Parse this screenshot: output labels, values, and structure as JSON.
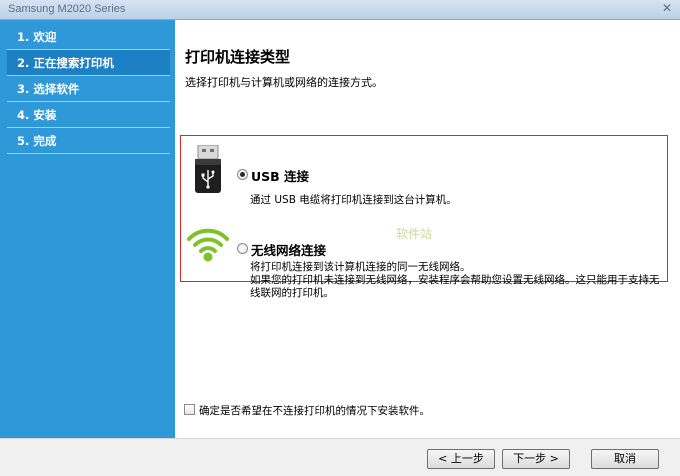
{
  "window": {
    "title": "Samsung M2020 Series",
    "close_glyph": "✕"
  },
  "sidebar": {
    "steps": [
      {
        "label": "1. 欢迎",
        "active": false
      },
      {
        "label": "2. 正在搜索打印机",
        "active": true
      },
      {
        "label": "3. 选择软件",
        "active": false
      },
      {
        "label": "4. 安装",
        "active": false
      },
      {
        "label": "5. 完成",
        "active": false
      }
    ]
  },
  "main": {
    "heading": "打印机连接类型",
    "subheading": "选择打印机与计算机或网络的连接方式。",
    "options": [
      {
        "icon": "usb-icon",
        "label": "USB 连接",
        "selected": true,
        "desc_lines": [
          "通过 USB 电缆将打印机连接到这台计算机。"
        ]
      },
      {
        "icon": "wifi-icon",
        "label": "无线网络连接",
        "selected": false,
        "desc_lines": [
          "将打印机连接到该计算机连接的同一无线网络。",
          "如果您的打印机未连接到无线网络，安装程序会帮助您设置无线网络。这只能用于支持无",
          "线联网的打印机。"
        ]
      }
    ],
    "watermark": "软件站",
    "skip_checkbox": {
      "label": "确定是否希望在不连接打印机的情况下安装软件。",
      "checked": false
    }
  },
  "buttons": {
    "back": "< 上一步",
    "next": "下一步 >",
    "cancel": "取消"
  },
  "colors": {
    "sidebar": "#2f98d8",
    "highlight_border": "#d42a2a",
    "wifi_green": "#7cc22a"
  }
}
